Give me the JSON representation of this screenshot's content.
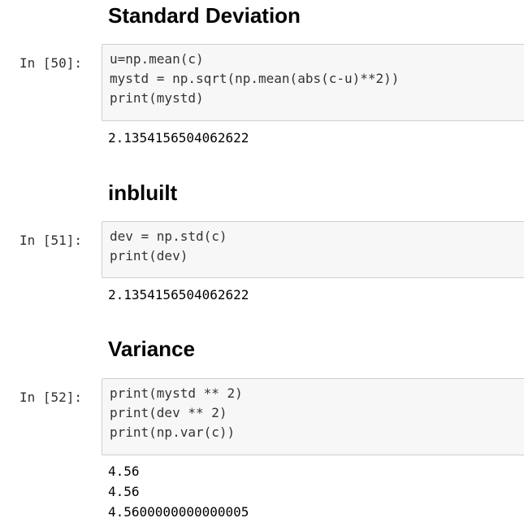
{
  "notebook": {
    "sections": [
      {
        "heading": "Standard Deviation",
        "prompt": "In [50]:",
        "code": [
          "u=np.mean(c)",
          "mystd = np.sqrt(np.mean(abs(c-u)**2))",
          "print(mystd)"
        ],
        "output": [
          "2.1354156504062622"
        ]
      },
      {
        "heading": "inbluilt",
        "prompt": "In [51]:",
        "code": [
          "dev = np.std(c)",
          "print(dev)"
        ],
        "output": [
          "2.1354156504062622"
        ]
      },
      {
        "heading": "Variance",
        "prompt": "In [52]:",
        "code": [
          "print(mystd ** 2)",
          "print(dev ** 2)",
          "print(np.var(c))"
        ],
        "output": [
          "4.56",
          "4.56",
          "4.5600000000000005"
        ]
      }
    ]
  }
}
